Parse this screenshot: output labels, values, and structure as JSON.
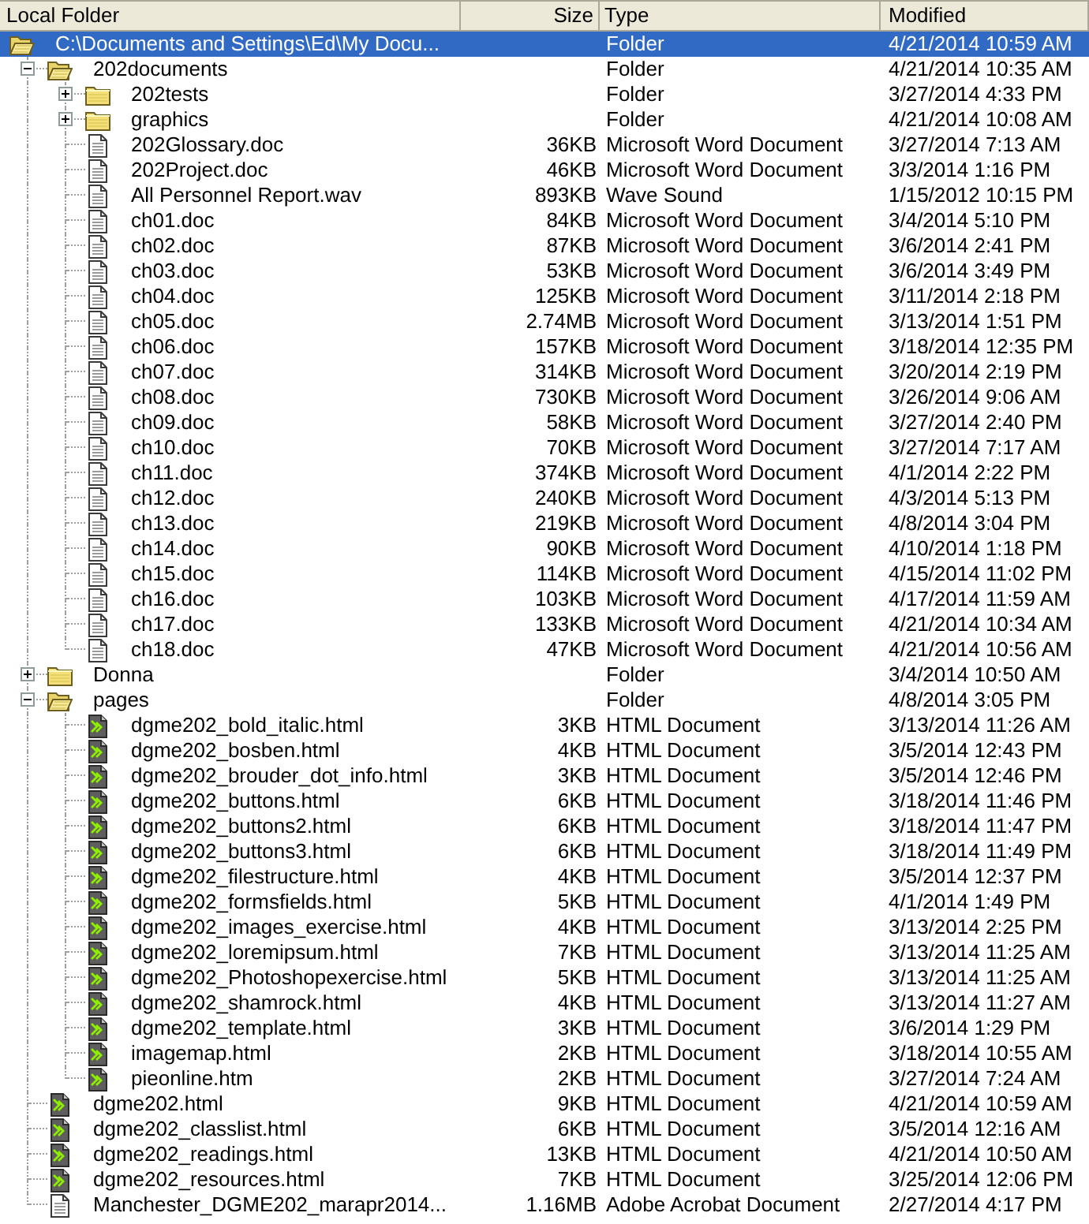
{
  "columns": [
    "Local Folder",
    "Size",
    "Type",
    "Modified"
  ],
  "items": [
    {
      "name": "C:\\Documents and Settings\\Ed\\My Docu...",
      "type": "Folder",
      "modified": "4/21/2014 10:59 AM",
      "kind": "folder",
      "expanded": true,
      "selected": true,
      "children": [
        {
          "name": "202documents",
          "type": "Folder",
          "modified": "4/21/2014 10:35 AM",
          "kind": "folder",
          "expanded": true,
          "selected": false,
          "children": [
            {
              "name": "202tests",
              "type": "Folder",
              "modified": "3/27/2014 4:33 PM",
              "kind": "folder",
              "expanded": false,
              "selected": false
            },
            {
              "name": "graphics",
              "type": "Folder",
              "modified": "4/21/2014 10:08 AM",
              "kind": "folder",
              "expanded": false,
              "selected": false
            },
            {
              "name": "202Glossary.doc",
              "size": "36KB",
              "type": "Microsoft Word Document",
              "modified": "3/27/2014 7:13 AM",
              "kind": "file",
              "selected": false
            },
            {
              "name": "202Project.doc",
              "size": "46KB",
              "type": "Microsoft Word Document",
              "modified": "3/3/2014 1:16 PM",
              "kind": "file",
              "selected": false
            },
            {
              "name": "All Personnel Report.wav",
              "size": "893KB",
              "type": "Wave Sound",
              "modified": "1/15/2012 10:15 PM",
              "kind": "file",
              "selected": false
            },
            {
              "name": "ch01.doc",
              "size": "84KB",
              "type": "Microsoft Word Document",
              "modified": "3/4/2014 5:10 PM",
              "kind": "file",
              "selected": false
            },
            {
              "name": "ch02.doc",
              "size": "87KB",
              "type": "Microsoft Word Document",
              "modified": "3/6/2014 2:41 PM",
              "kind": "file",
              "selected": false
            },
            {
              "name": "ch03.doc",
              "size": "53KB",
              "type": "Microsoft Word Document",
              "modified": "3/6/2014 3:49 PM",
              "kind": "file",
              "selected": false
            },
            {
              "name": "ch04.doc",
              "size": "125KB",
              "type": "Microsoft Word Document",
              "modified": "3/11/2014 2:18 PM",
              "kind": "file",
              "selected": false
            },
            {
              "name": "ch05.doc",
              "size": "2.74MB",
              "type": "Microsoft Word Document",
              "modified": "3/13/2014 1:51 PM",
              "kind": "file",
              "selected": false
            },
            {
              "name": "ch06.doc",
              "size": "157KB",
              "type": "Microsoft Word Document",
              "modified": "3/18/2014 12:35 PM",
              "kind": "file",
              "selected": false
            },
            {
              "name": "ch07.doc",
              "size": "314KB",
              "type": "Microsoft Word Document",
              "modified": "3/20/2014 2:19 PM",
              "kind": "file",
              "selected": false
            },
            {
              "name": "ch08.doc",
              "size": "730KB",
              "type": "Microsoft Word Document",
              "modified": "3/26/2014 9:06 AM",
              "kind": "file",
              "selected": false
            },
            {
              "name": "ch09.doc",
              "size": "58KB",
              "type": "Microsoft Word Document",
              "modified": "3/27/2014 2:40 PM",
              "kind": "file",
              "selected": false
            },
            {
              "name": "ch10.doc",
              "size": "70KB",
              "type": "Microsoft Word Document",
              "modified": "3/27/2014 7:17 AM",
              "kind": "file",
              "selected": false
            },
            {
              "name": "ch11.doc",
              "size": "374KB",
              "type": "Microsoft Word Document",
              "modified": "4/1/2014 2:22 PM",
              "kind": "file",
              "selected": false
            },
            {
              "name": "ch12.doc",
              "size": "240KB",
              "type": "Microsoft Word Document",
              "modified": "4/3/2014 5:13 PM",
              "kind": "file",
              "selected": false
            },
            {
              "name": "ch13.doc",
              "size": "219KB",
              "type": "Microsoft Word Document",
              "modified": "4/8/2014 3:04 PM",
              "kind": "file",
              "selected": false
            },
            {
              "name": "ch14.doc",
              "size": "90KB",
              "type": "Microsoft Word Document",
              "modified": "4/10/2014 1:18 PM",
              "kind": "file",
              "selected": false
            },
            {
              "name": "ch15.doc",
              "size": "114KB",
              "type": "Microsoft Word Document",
              "modified": "4/15/2014 11:02 PM",
              "kind": "file",
              "selected": false
            },
            {
              "name": "ch16.doc",
              "size": "103KB",
              "type": "Microsoft Word Document",
              "modified": "4/17/2014 11:59 AM",
              "kind": "file",
              "selected": false
            },
            {
              "name": "ch17.doc",
              "size": "133KB",
              "type": "Microsoft Word Document",
              "modified": "4/21/2014 10:34 AM",
              "kind": "file",
              "selected": false
            },
            {
              "name": "ch18.doc",
              "size": "47KB",
              "type": "Microsoft Word Document",
              "modified": "4/21/2014 10:56 AM",
              "kind": "file",
              "selected": false
            }
          ]
        },
        {
          "name": "Donna",
          "type": "Folder",
          "modified": "3/4/2014 10:50 AM",
          "kind": "folder",
          "expanded": false,
          "selected": false
        },
        {
          "name": "pages",
          "type": "Folder",
          "modified": "4/8/2014 3:05 PM",
          "kind": "folder",
          "expanded": true,
          "selected": false,
          "children": [
            {
              "name": "dgme202_bold_italic.html",
              "size": "3KB",
              "type": "HTML Document",
              "modified": "3/13/2014 11:26 AM",
              "kind": "html",
              "selected": false
            },
            {
              "name": "dgme202_bosben.html",
              "size": "4KB",
              "type": "HTML Document",
              "modified": "3/5/2014 12:43 PM",
              "kind": "html",
              "selected": false
            },
            {
              "name": "dgme202_brouder_dot_info.html",
              "size": "3KB",
              "type": "HTML Document",
              "modified": "3/5/2014 12:46 PM",
              "kind": "html",
              "selected": false
            },
            {
              "name": "dgme202_buttons.html",
              "size": "6KB",
              "type": "HTML Document",
              "modified": "3/18/2014 11:46 PM",
              "kind": "html",
              "selected": false
            },
            {
              "name": "dgme202_buttons2.html",
              "size": "6KB",
              "type": "HTML Document",
              "modified": "3/18/2014 11:47 PM",
              "kind": "html",
              "selected": false
            },
            {
              "name": "dgme202_buttons3.html",
              "size": "6KB",
              "type": "HTML Document",
              "modified": "3/18/2014 11:49 PM",
              "kind": "html",
              "selected": false
            },
            {
              "name": "dgme202_filestructure.html",
              "size": "4KB",
              "type": "HTML Document",
              "modified": "3/5/2014 12:37 PM",
              "kind": "html",
              "selected": false
            },
            {
              "name": "dgme202_formsfields.html",
              "size": "5KB",
              "type": "HTML Document",
              "modified": "4/1/2014 1:49 PM",
              "kind": "html",
              "selected": false
            },
            {
              "name": "dgme202_images_exercise.html",
              "size": "4KB",
              "type": "HTML Document",
              "modified": "3/13/2014 2:25 PM",
              "kind": "html",
              "selected": false
            },
            {
              "name": "dgme202_loremipsum.html",
              "size": "7KB",
              "type": "HTML Document",
              "modified": "3/13/2014 11:25 AM",
              "kind": "html",
              "selected": false
            },
            {
              "name": "dgme202_Photoshopexercise.html",
              "size": "5KB",
              "type": "HTML Document",
              "modified": "3/13/2014 11:25 AM",
              "kind": "html",
              "selected": false
            },
            {
              "name": "dgme202_shamrock.html",
              "size": "4KB",
              "type": "HTML Document",
              "modified": "3/13/2014 11:27 AM",
              "kind": "html",
              "selected": false
            },
            {
              "name": "dgme202_template.html",
              "size": "3KB",
              "type": "HTML Document",
              "modified": "3/6/2014 1:29 PM",
              "kind": "html",
              "selected": false
            },
            {
              "name": "imagemap.html",
              "size": "2KB",
              "type": "HTML Document",
              "modified": "3/18/2014 10:55 AM",
              "kind": "html",
              "selected": false
            },
            {
              "name": "pieonline.htm",
              "size": "2KB",
              "type": "HTML Document",
              "modified": "3/27/2014 7:24 AM",
              "kind": "html",
              "selected": false
            }
          ]
        },
        {
          "name": "dgme202.html",
          "size": "9KB",
          "type": "HTML Document",
          "modified": "4/21/2014 10:59 AM",
          "kind": "html",
          "selected": false
        },
        {
          "name": "dgme202_classlist.html",
          "size": "6KB",
          "type": "HTML Document",
          "modified": "3/5/2014 12:16 AM",
          "kind": "html",
          "selected": false
        },
        {
          "name": "dgme202_readings.html",
          "size": "13KB",
          "type": "HTML Document",
          "modified": "4/21/2014 10:50 AM",
          "kind": "html",
          "selected": false
        },
        {
          "name": "dgme202_resources.html",
          "size": "7KB",
          "type": "HTML Document",
          "modified": "3/25/2014 12:06 PM",
          "kind": "html",
          "selected": false
        },
        {
          "name": "Manchester_DGME202_marapr2014...",
          "size": "1.16MB",
          "type": "Adobe Acrobat Document",
          "modified": "2/27/2014 4:17 PM",
          "kind": "file",
          "selected": false
        }
      ]
    }
  ]
}
